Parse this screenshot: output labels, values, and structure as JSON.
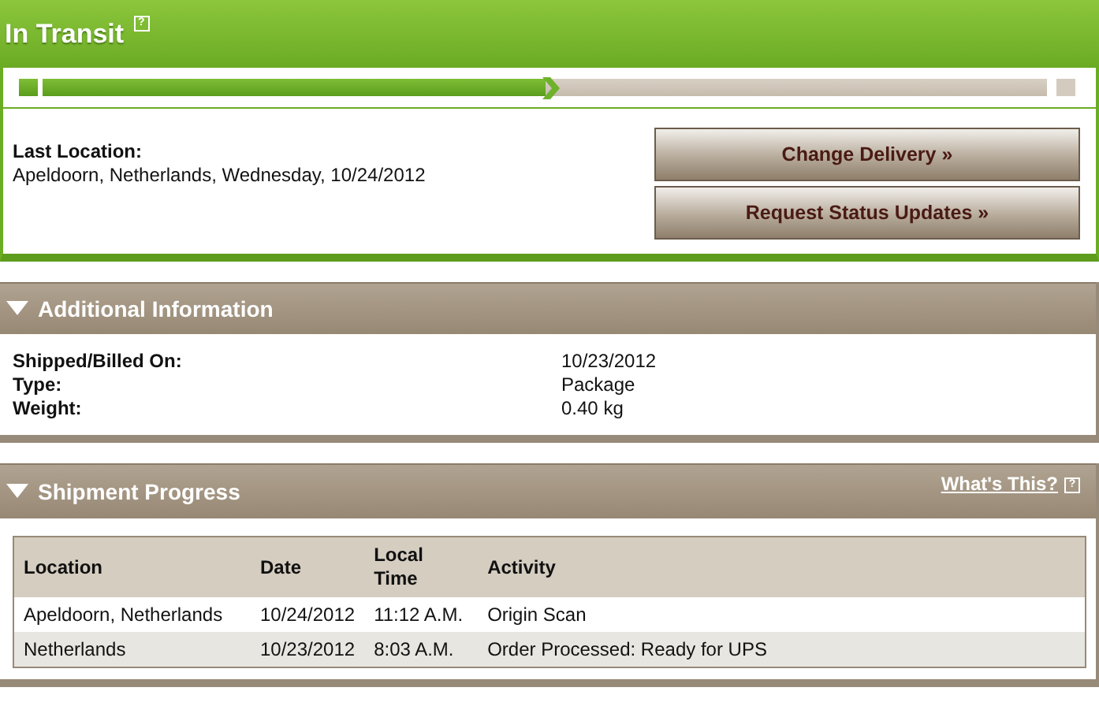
{
  "status": {
    "title": "In Transit",
    "help": "?",
    "progress": {
      "level": 0.5
    }
  },
  "last_location": {
    "label": "Last Location:",
    "value": "Apeldoorn, Netherlands, Wednesday, 10/24/2012"
  },
  "buttons": [
    "Change Delivery »",
    "Request Status Updates »"
  ],
  "additional_information": {
    "title": "Additional Information",
    "expanded": true,
    "rows": [
      {
        "label": "Shipped/Billed On:",
        "value": "10/23/2012"
      },
      {
        "label": "Type:",
        "value": "Package"
      },
      {
        "label": "Weight:",
        "value": "0.40 kg"
      }
    ]
  },
  "shipment_progress": {
    "title": "Shipment Progress",
    "expanded": true,
    "link": "What's This?",
    "help": "?",
    "table": {
      "columns": [
        "Location",
        "Date",
        "Local Time",
        "Activity"
      ],
      "rows": [
        [
          "Apeldoorn, Netherlands",
          "10/24/2012",
          "11:12 A.M.",
          "Origin Scan"
        ],
        [
          "Netherlands",
          "10/23/2012",
          "8:03 A.M.",
          "Order Processed: Ready for UPS"
        ]
      ]
    }
  }
}
